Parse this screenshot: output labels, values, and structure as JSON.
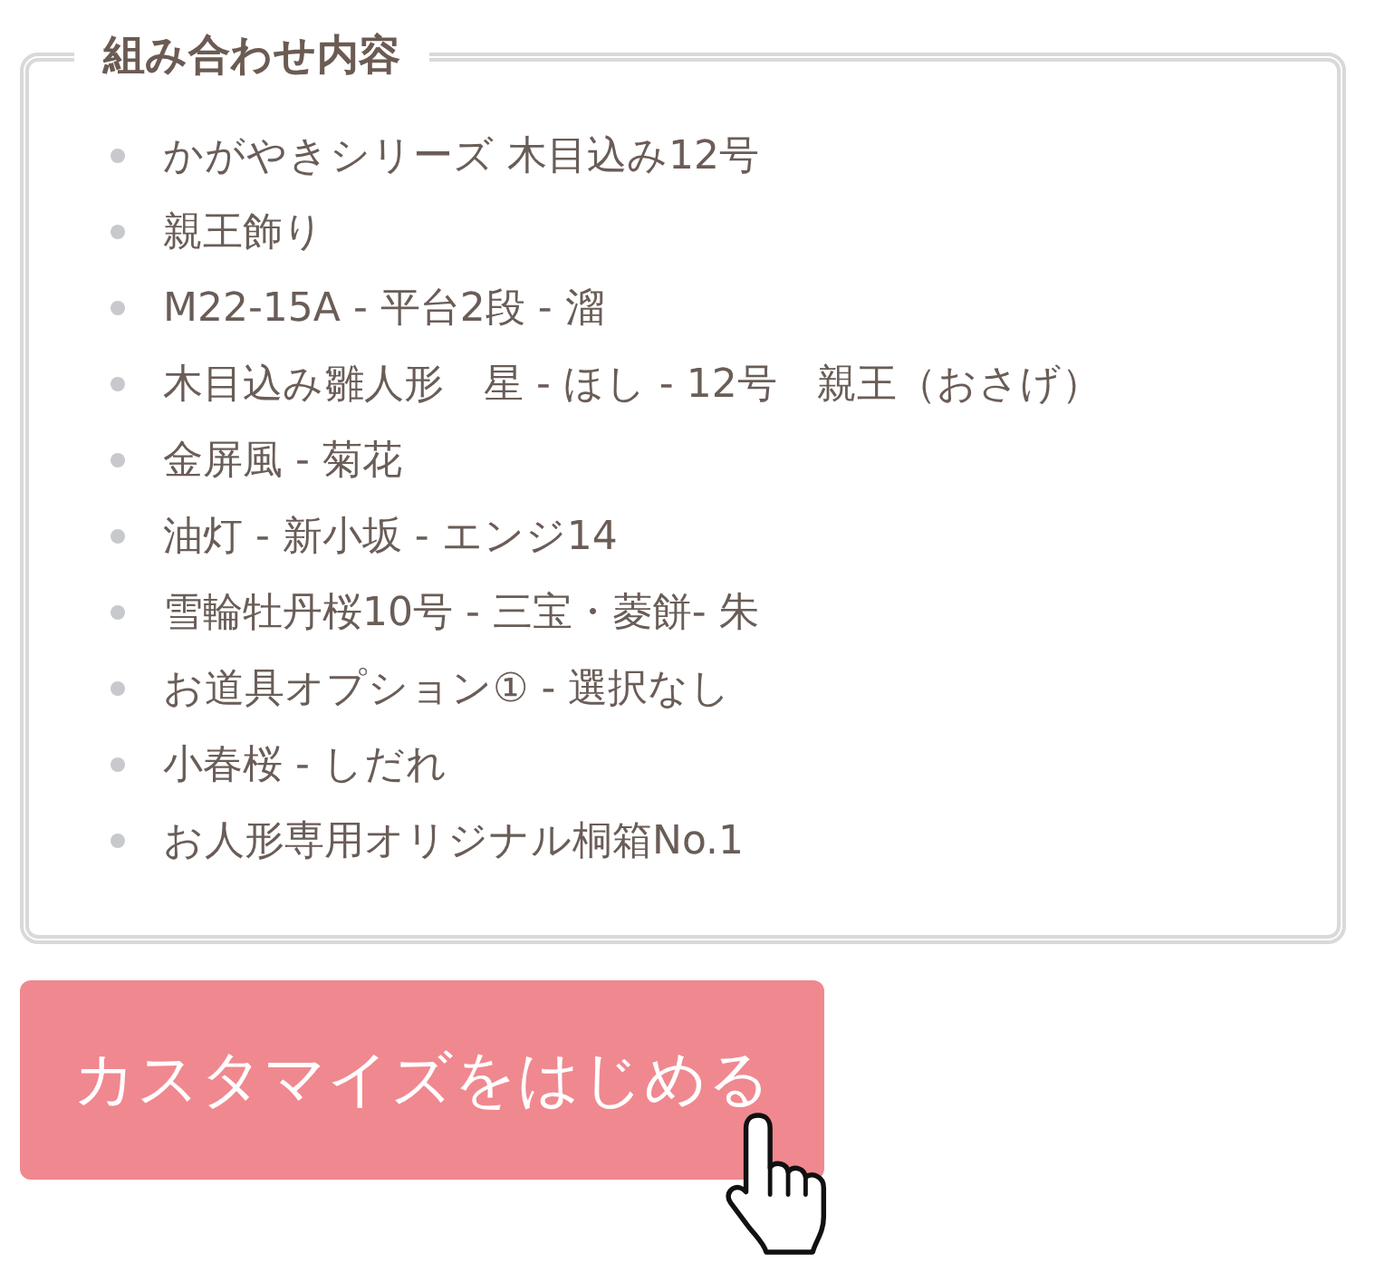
{
  "panel": {
    "title": "組み合わせ内容",
    "items": [
      "かがやきシリーズ 木目込み12号",
      "親王飾り",
      "M22-15A - 平台2段 - 溜",
      "木目込み雛人形　星 - ほし - 12号　親王（おさげ）",
      "金屏風 - 菊花",
      "油灯 - 新小坂 - エンジ14",
      "雪輪牡丹桜10号 - 三宝・菱餅- 朱",
      "お道具オプション① - 選択なし",
      "小春桜 - しだれ",
      "お人形専用オリジナル桐箱No.1"
    ]
  },
  "button": {
    "label": "カスタマイズをはじめる"
  }
}
